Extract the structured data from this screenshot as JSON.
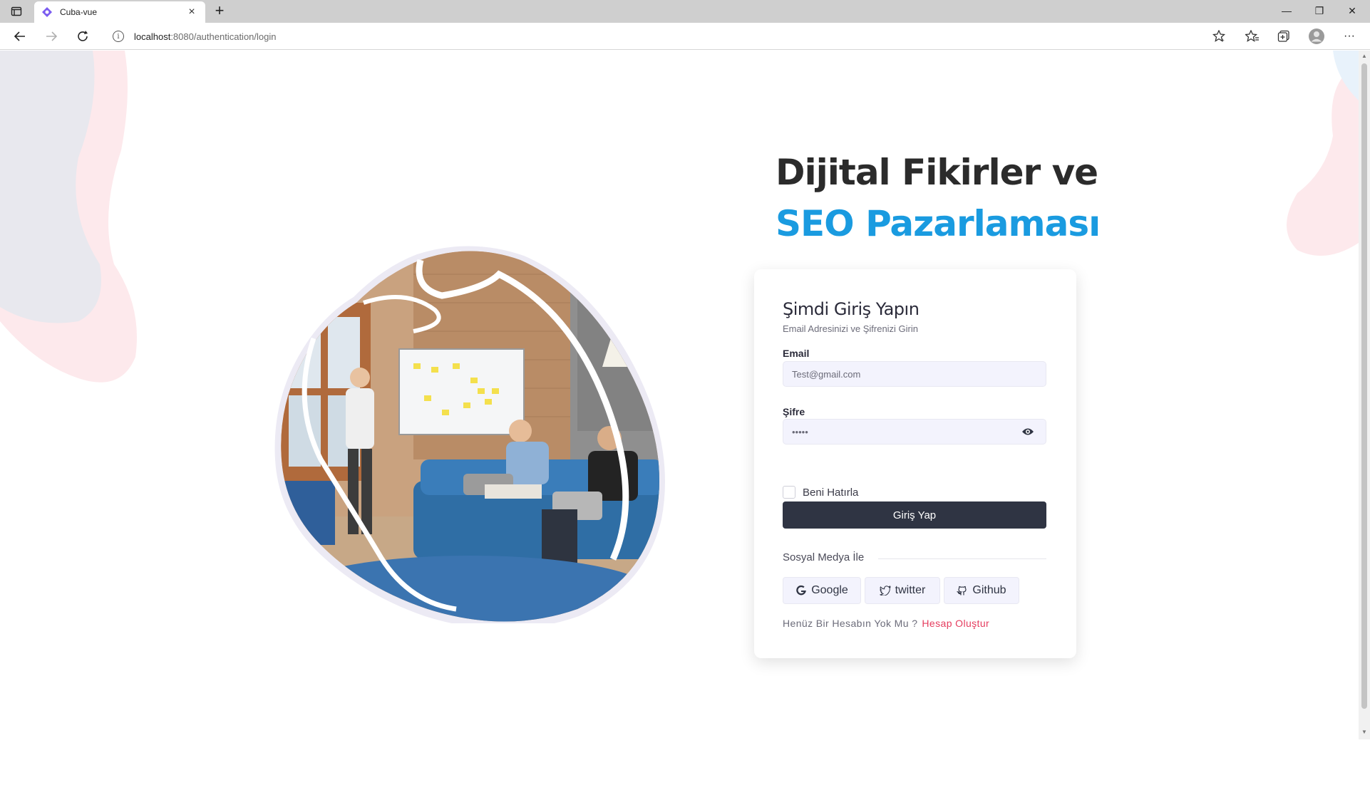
{
  "browser": {
    "tab_title": "Cuba-vue",
    "url_host": "localhost",
    "url_path": ":8080/authentication/login",
    "new_tab": "+",
    "close_tab": "×",
    "minimize": "—",
    "restore": "❐",
    "close_window": "✕",
    "more": "···"
  },
  "hero": {
    "title_line1": "Dijital Fikirler ve",
    "title_line2": "SEO Pazarlaması"
  },
  "login": {
    "heading": "Şimdi Giriş Yapın",
    "subheading": "Email Adresinizi ve Şifrenizi Girin",
    "email_label": "Email",
    "email_value": "Test@gmail.com",
    "password_label": "Şifre",
    "password_value": "•••••",
    "remember_label": "Beni Hatırla",
    "submit_label": "Giriş Yap",
    "social_title": "Sosyal Medya İle",
    "social": {
      "google": "Google",
      "twitter": "twitter",
      "github": "Github"
    },
    "no_account_text": "Henüz Bir Hesabın Yok Mu ?",
    "signup_link": "Hesap Oluştur"
  },
  "colors": {
    "accent_blue": "#1a9be0",
    "dark_button": "#2f3443",
    "link_red": "#e53c5e"
  }
}
